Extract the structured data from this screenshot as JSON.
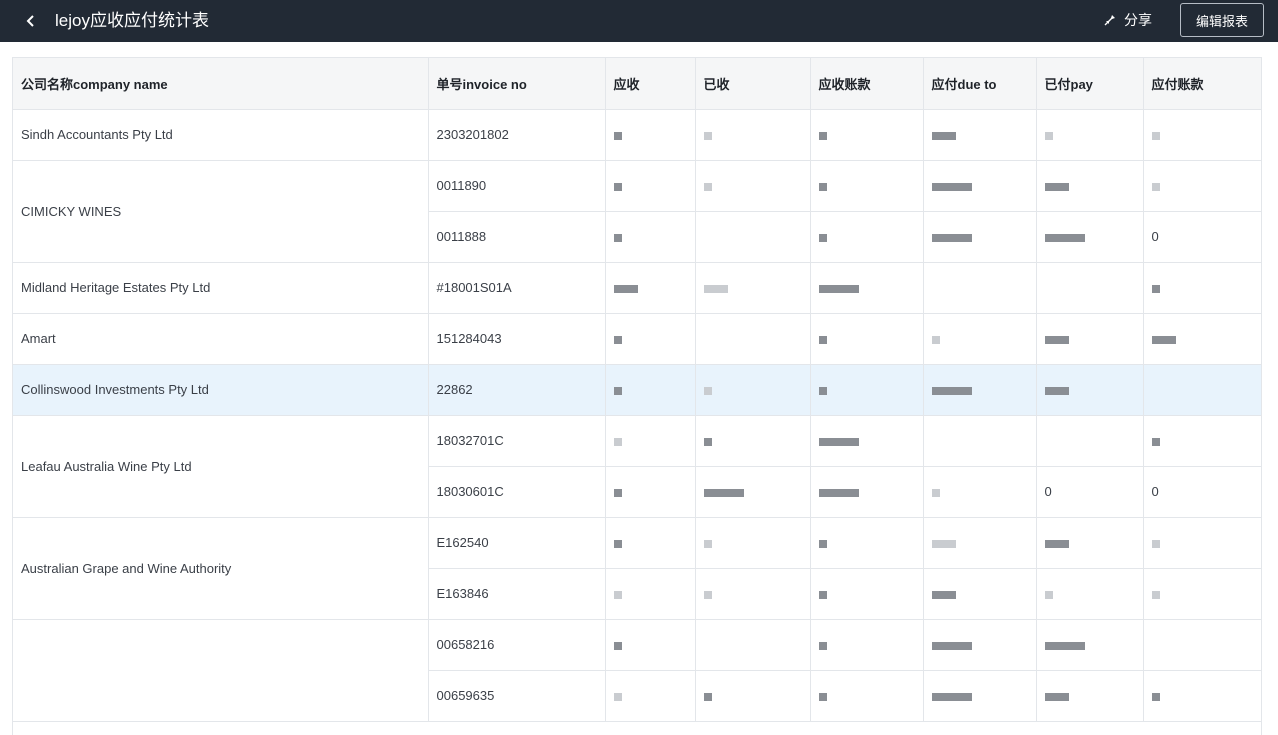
{
  "header": {
    "title": "lejoy应收应付统计表",
    "share_label": "分享",
    "edit_label": "编辑报表",
    "back_icon": "chevron-left-icon",
    "share_icon": "pin-icon"
  },
  "table": {
    "columns": [
      "公司名称company name",
      "单号invoice no",
      "应收",
      "已收",
      "应收账款",
      "应付due to",
      "已付pay",
      "应付账款"
    ],
    "groups": [
      {
        "company": "Sindh Accountants Pty Ltd",
        "invoices": [
          "2303201802"
        ]
      },
      {
        "company": "CIMICKY WINES",
        "invoices": [
          "0011890",
          "0011888"
        ]
      },
      {
        "company": "Midland Heritage Estates Pty Ltd",
        "invoices": [
          "#18001S01A"
        ]
      },
      {
        "company": "Amart",
        "invoices": [
          "151284043"
        ]
      },
      {
        "company": "Collinswood Investments Pty Ltd",
        "invoices": [
          "22862"
        ],
        "highlight": true
      },
      {
        "company": "Leafau Australia Wine Pty Ltd",
        "invoices": [
          "18032701C",
          "18030601C"
        ]
      },
      {
        "company": "Australian Grape and Wine Authority",
        "invoices": [
          "E162540",
          "E163846"
        ]
      },
      {
        "company": "",
        "invoices": [
          "00658216",
          "00659635"
        ]
      }
    ],
    "visible_values": {
      "zero_1": "0",
      "zero_2": "0",
      "zero_3": "0"
    }
  },
  "colors": {
    "topbar": "#222a35",
    "header_row": "#f5f6f7",
    "highlight_row": "#e8f3fc",
    "border": "#e3e6ea"
  }
}
